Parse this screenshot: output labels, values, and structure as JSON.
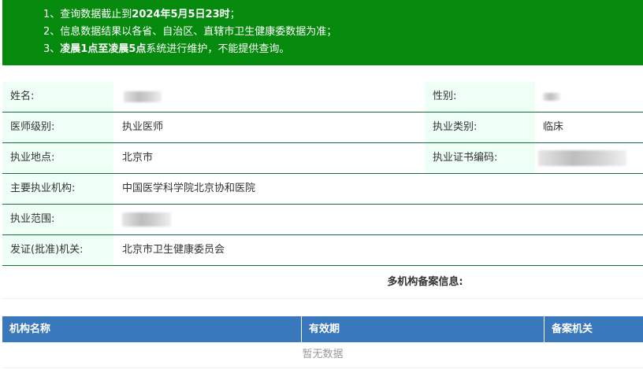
{
  "notice": {
    "line1_prefix": "1、查询数据截止到",
    "line1_bold": "2024年5月5日23时",
    "line1_suffix": "；",
    "line2": "2、信息数据结果以各省、自治区、直辖市卫生健康委数据为准；",
    "line3_prefix": "3、",
    "line3_bold": "凌晨1点至凌晨5点",
    "line3_suffix": "系统进行维护，不能提供查询。",
    "bg_color": "#058a0e"
  },
  "info": {
    "name_label": "姓名:",
    "gender_label": "性别:",
    "level_label": "医师级别:",
    "level_value": "执业医师",
    "category_label": "执业类别:",
    "category_value": "临床",
    "location_label": "执业地点:",
    "location_value": "北京市",
    "cert_label": "执业证书编码:",
    "institution_label": "主要执业机构:",
    "institution_value": "中国医学科学院北京协和医院",
    "scope_label": "执业范围:",
    "issuer_label": "发证(批准)机关:",
    "issuer_value": "北京市卫生健康委员会"
  },
  "multi_record": {
    "title": "多机构备案信息:"
  },
  "table": {
    "columns": [
      "机构名称",
      "有效期",
      "备案机关"
    ],
    "empty_text": "暂无数据",
    "header_color": "#3a78bd"
  }
}
